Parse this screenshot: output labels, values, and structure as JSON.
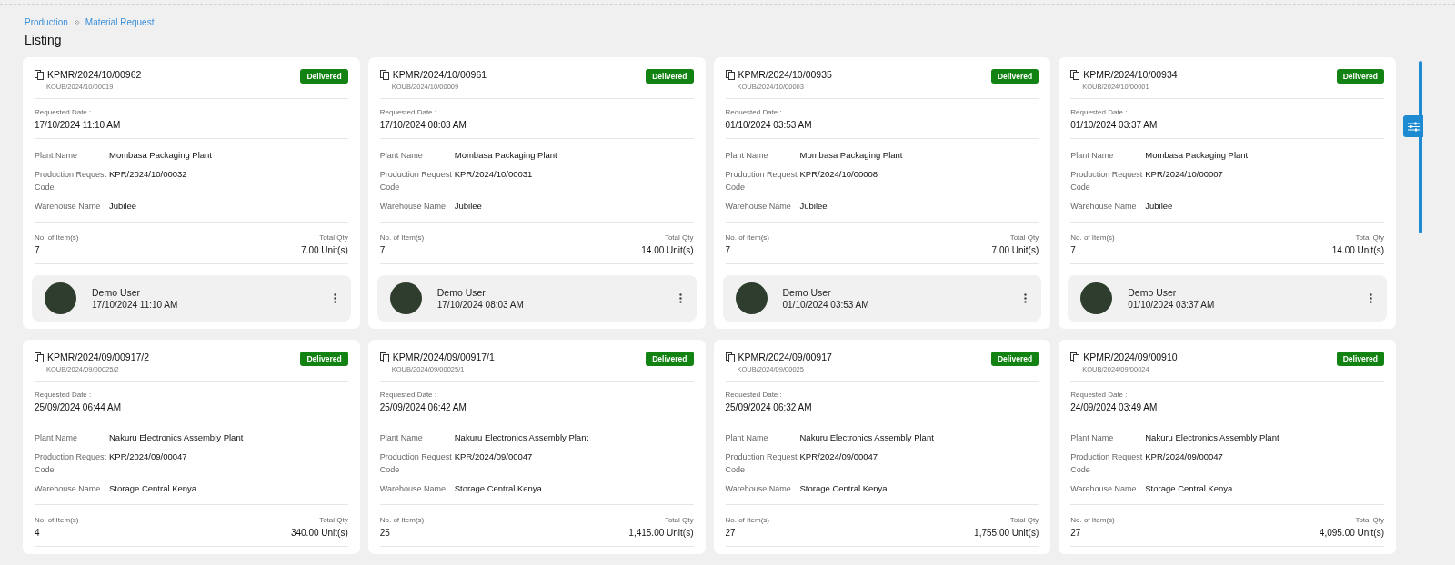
{
  "breadcrumb": [
    {
      "label": "Production"
    },
    {
      "label": "Material Request"
    }
  ],
  "page_title": "Listing",
  "cards": [
    {
      "code": "KPMR/2024/10/00962",
      "sub_code": "KOUB/2024/10/00019",
      "status": "Delivered",
      "date_label": "Requested Date :",
      "date": "17/10/2024 11:10 AM",
      "fields": [
        {
          "label": "Plant Name",
          "value": "Mombasa Packaging Plant"
        },
        {
          "label": "Production Request Code",
          "value": "KPR/2024/10/00032"
        },
        {
          "label": "Warehouse Name",
          "value": "Jubilee"
        }
      ],
      "items_label": "No. of Item(s)",
      "items": "7",
      "qty_label": "Total Qty",
      "qty": "7.00 Unit(s)",
      "user": {
        "name": "Demo User",
        "time": "17/10/2024 11:10 AM"
      }
    },
    {
      "code": "KPMR/2024/10/00961",
      "sub_code": "KOUB/2024/10/00009",
      "status": "Delivered",
      "date_label": "Requested Date :",
      "date": "17/10/2024 08:03 AM",
      "fields": [
        {
          "label": "Plant Name",
          "value": "Mombasa Packaging Plant"
        },
        {
          "label": "Production Request Code",
          "value": "KPR/2024/10/00031"
        },
        {
          "label": "Warehouse Name",
          "value": "Jubilee"
        }
      ],
      "items_label": "No. of Item(s)",
      "items": "7",
      "qty_label": "Total Qty",
      "qty": "14.00 Unit(s)",
      "user": {
        "name": "Demo User",
        "time": "17/10/2024 08:03 AM"
      }
    },
    {
      "code": "KPMR/2024/10/00935",
      "sub_code": "KOUB/2024/10/00003",
      "status": "Delivered",
      "date_label": "Requested Date :",
      "date": "01/10/2024 03:53 AM",
      "fields": [
        {
          "label": "Plant Name",
          "value": "Mombasa Packaging Plant"
        },
        {
          "label": "Production Request Code",
          "value": "KPR/2024/10/00008"
        },
        {
          "label": "Warehouse Name",
          "value": "Jubilee"
        }
      ],
      "items_label": "No. of Item(s)",
      "items": "7",
      "qty_label": "Total Qty",
      "qty": "7.00 Unit(s)",
      "user": {
        "name": "Demo User",
        "time": "01/10/2024 03:53 AM"
      }
    },
    {
      "code": "KPMR/2024/10/00934",
      "sub_code": "KOUB/2024/10/00001",
      "status": "Delivered",
      "date_label": "Requested Date :",
      "date": "01/10/2024 03:37 AM",
      "fields": [
        {
          "label": "Plant Name",
          "value": "Mombasa Packaging Plant"
        },
        {
          "label": "Production Request Code",
          "value": "KPR/2024/10/00007"
        },
        {
          "label": "Warehouse Name",
          "value": "Jubilee"
        }
      ],
      "items_label": "No. of Item(s)",
      "items": "7",
      "qty_label": "Total Qty",
      "qty": "14.00 Unit(s)",
      "user": {
        "name": "Demo User",
        "time": "01/10/2024 03:37 AM"
      }
    },
    {
      "code": "KPMR/2024/09/00917/2",
      "sub_code": "KOUB/2024/09/00025/2",
      "status": "Delivered",
      "date_label": "Requested Date :",
      "date": "25/09/2024 06:44 AM",
      "fields": [
        {
          "label": "Plant Name",
          "value": "Nakuru Electronics Assembly Plant"
        },
        {
          "label": "Production Request Code",
          "value": "KPR/2024/09/00047"
        },
        {
          "label": "Warehouse Name",
          "value": "Storage Central Kenya"
        }
      ],
      "items_label": "No. of Item(s)",
      "items": "4",
      "qty_label": "Total Qty",
      "qty": "340.00 Unit(s)"
    },
    {
      "code": "KPMR/2024/09/00917/1",
      "sub_code": "KOUB/2024/09/00025/1",
      "status": "Delivered",
      "date_label": "Requested Date :",
      "date": "25/09/2024 06:42 AM",
      "fields": [
        {
          "label": "Plant Name",
          "value": "Nakuru Electronics Assembly Plant"
        },
        {
          "label": "Production Request Code",
          "value": "KPR/2024/09/00047"
        },
        {
          "label": "Warehouse Name",
          "value": "Storage Central Kenya"
        }
      ],
      "items_label": "No. of Item(s)",
      "items": "25",
      "qty_label": "Total Qty",
      "qty": "1,415.00 Unit(s)"
    },
    {
      "code": "KPMR/2024/09/00917",
      "sub_code": "KOUB/2024/09/00025",
      "status": "Delivered",
      "date_label": "Requested Date :",
      "date": "25/09/2024 06:32 AM",
      "fields": [
        {
          "label": "Plant Name",
          "value": "Nakuru Electronics Assembly Plant"
        },
        {
          "label": "Production Request Code",
          "value": "KPR/2024/09/00047"
        },
        {
          "label": "Warehouse Name",
          "value": "Storage Central Kenya"
        }
      ],
      "items_label": "No. of Item(s)",
      "items": "27",
      "qty_label": "Total Qty",
      "qty": "1,755.00 Unit(s)"
    },
    {
      "code": "KPMR/2024/09/00910",
      "sub_code": "KOUB/2024/09/00024",
      "status": "Delivered",
      "date_label": "Requested Date :",
      "date": "24/09/2024 03:49 AM",
      "fields": [
        {
          "label": "Plant Name",
          "value": "Nakuru Electronics Assembly Plant"
        },
        {
          "label": "Production Request Code",
          "value": "KPR/2024/09/00047"
        },
        {
          "label": "Warehouse Name",
          "value": "Storage Central Kenya"
        }
      ],
      "items_label": "No. of Item(s)",
      "items": "27",
      "qty_label": "Total Qty",
      "qty": "4,095.00 Unit(s)"
    }
  ]
}
